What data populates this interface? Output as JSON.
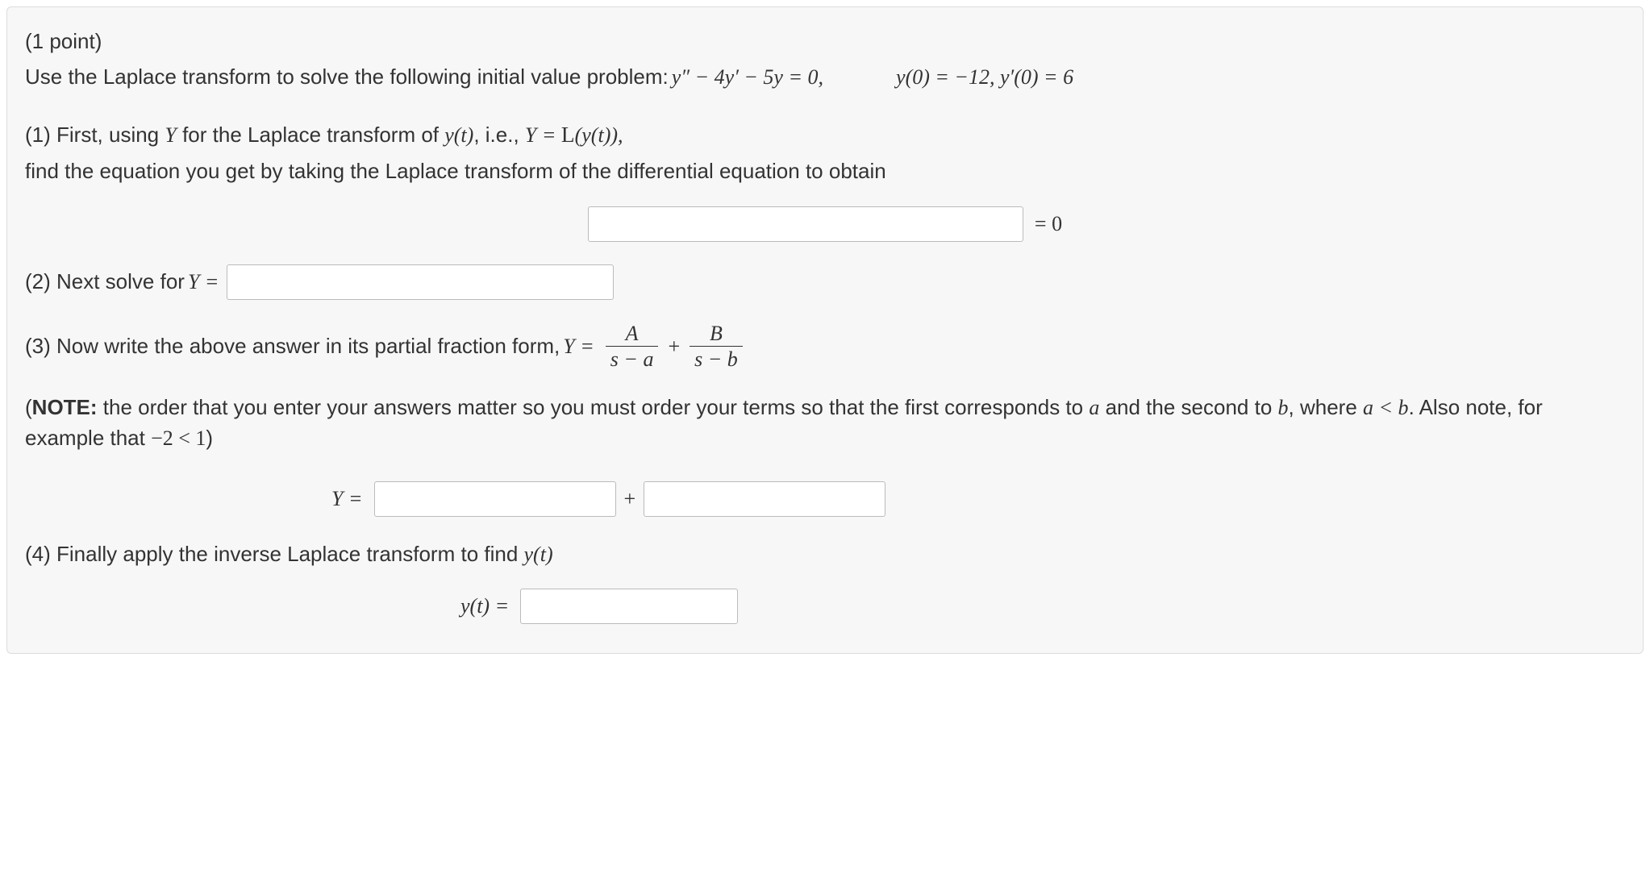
{
  "header": {
    "points": "(1 point)",
    "prompt_prefix": "Use the Laplace transform to solve the following initial value problem: ",
    "ode": "y″ − 4y′ − 5y = 0,",
    "ic": "y(0) = −12,  y′(0) = 6"
  },
  "part1": {
    "line1_prefix": "(1) First, using ",
    "Y": "Y",
    "line1_mid": " for the Laplace transform of ",
    "yt": "y(t)",
    "line1_mid2": ", i.e., ",
    "eq": "Y = ",
    "Lop": "L",
    "Larg": "(y(t)),",
    "line2": "find the equation you get by taking the Laplace transform of the differential equation to obtain",
    "rhs": "= 0"
  },
  "part2": {
    "prefix": "(2) Next solve for ",
    "Y_eq": "Y ="
  },
  "part3": {
    "prefix": "(3) Now write the above answer in its partial fraction form, ",
    "Y_eq": "Y =",
    "A": "A",
    "B": "B",
    "sa": "s − a",
    "sb": "s − b",
    "plus": "+"
  },
  "note": {
    "label": "NOTE:",
    "text1": " the order that you enter your answers matter so you must order your terms so that the first corresponds to ",
    "a": "a",
    "text2": " and the second to ",
    "b": "b",
    "text3": ", where ",
    "cond": "a < b",
    "text4": ". Also note, for example that ",
    "example": "−2 < 1",
    "text5": ")"
  },
  "partial_row": {
    "Y_eq": "Y =",
    "plus": "+"
  },
  "part4": {
    "text": "(4) Finally apply the inverse Laplace transform to find ",
    "yt": "y(t)",
    "lhs": "y(t) ="
  }
}
